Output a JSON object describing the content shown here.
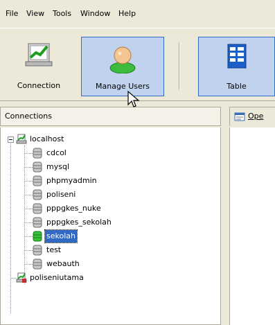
{
  "menu": [
    "File",
    "View",
    "Tools",
    "Window",
    "Help"
  ],
  "toolbar": {
    "connection_label": "Connection",
    "manage_users_label": "Manage Users",
    "table_label": "Table"
  },
  "connections_panel": {
    "title": "Connections",
    "servers": [
      {
        "label": "localhost",
        "icon": "server-icon",
        "databases": [
          "cdcol",
          "mysql",
          "phpmyadmin",
          "poliseni",
          "pppgkes_nuke",
          "pppgkes_sekolah",
          "sekolah",
          "test",
          "webauth"
        ],
        "selected": "sekolah"
      },
      {
        "label": "poliseniutama",
        "icon": "server-icon"
      }
    ]
  },
  "right_panel": {
    "tab_label": "Ope"
  },
  "colors": {
    "selection": "#316ac5",
    "active_button_bg": "#c1d2ee",
    "window_bg": "#ece9d8"
  }
}
